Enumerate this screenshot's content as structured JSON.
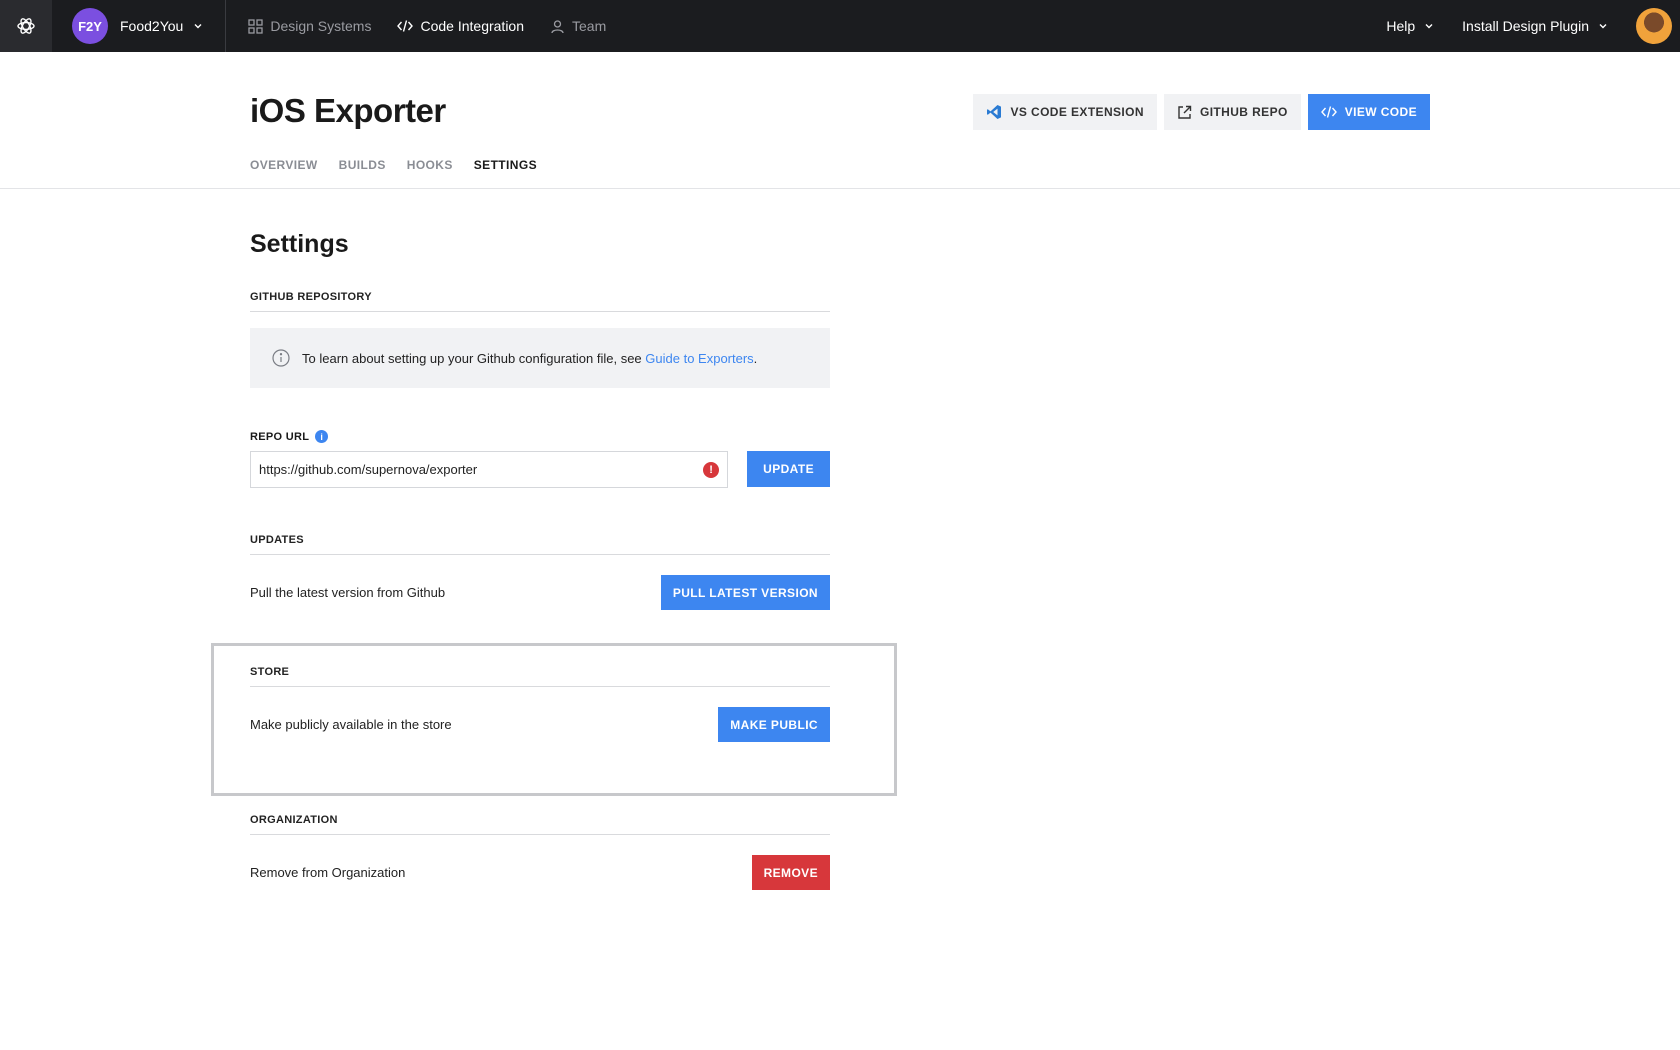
{
  "topbar": {
    "org_initials": "F2Y",
    "org_name": "Food2You",
    "nav": [
      {
        "label": "Design Systems"
      },
      {
        "label": "Code Integration"
      },
      {
        "label": "Team"
      }
    ],
    "help": "Help",
    "install_plugin": "Install Design Plugin"
  },
  "header": {
    "title": "iOS Exporter",
    "actions": {
      "vscode": "VS CODE EXTENSION",
      "github": "GITHUB REPO",
      "view_code": "VIEW CODE"
    },
    "tabs": [
      "OVERVIEW",
      "BUILDS",
      "HOOKS",
      "SETTINGS"
    ]
  },
  "settings": {
    "title": "Settings",
    "github": {
      "label": "GITHUB REPOSITORY",
      "info_text": "To learn about setting up your Github configuration file, see ",
      "info_link": "Guide to Exporters",
      "info_end": "."
    },
    "repo": {
      "label": "REPO URL",
      "info_glyph": "i",
      "value": "https://github.com/supernova/exporter",
      "error_glyph": "!",
      "button": "UPDATE"
    },
    "updates": {
      "label": "UPDATES",
      "text": "Pull the latest version from Github",
      "button": "PULL LATEST VERSION"
    },
    "store": {
      "label": "STORE",
      "text": "Make publicly available in the store",
      "button": "MAKE PUBLIC"
    },
    "organization": {
      "label": "ORGANIZATION",
      "text": "Remove from Organization",
      "button": "REMOVE"
    }
  },
  "colors": {
    "topbar_bg": "#1b1c1f",
    "accent": "#3d86f0",
    "danger": "#d7373b",
    "org_avatar": "#7b4fe0"
  },
  "icons": [
    "supernova-logo-icon",
    "chevron-down-icon",
    "grid-icon",
    "code-icon",
    "user-icon",
    "vscode-icon",
    "external-link-icon",
    "info-icon",
    "error-icon"
  ]
}
